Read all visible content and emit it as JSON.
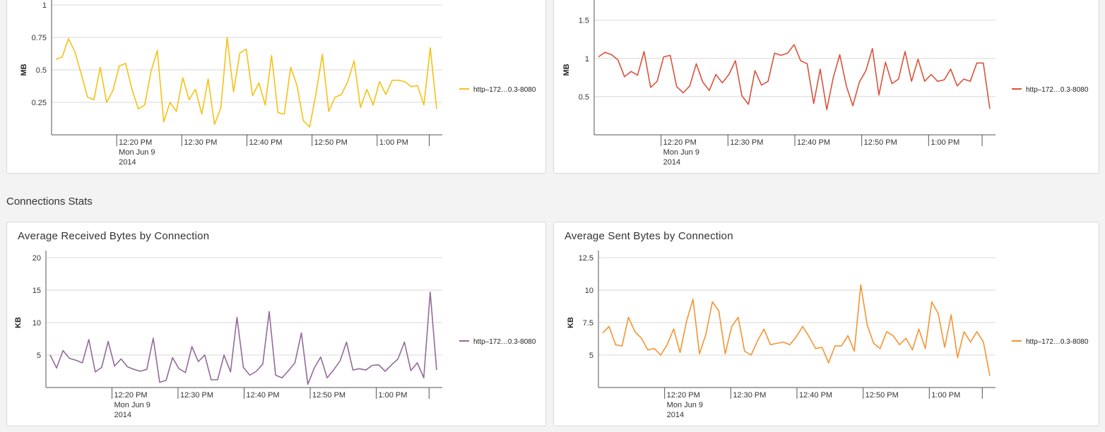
{
  "section": {
    "title": "Connections Stats"
  },
  "charts": [
    {
      "id": "top-left",
      "title": "",
      "ylabel": "MB",
      "yticks": [
        "1",
        "0.75",
        "0.5",
        "0.25"
      ],
      "xticks": [
        "12:20 PM",
        "12:30 PM",
        "12:40 PM",
        "12:50 PM",
        "1:00 PM"
      ],
      "xsub": [
        "Mon Jun 9",
        "2014"
      ],
      "legend": "http–172…0.3-8080",
      "color": "#f5c115"
    },
    {
      "id": "top-right",
      "title": "",
      "ylabel": "MB",
      "yticks": [
        "1.5",
        "1",
        "0.5"
      ],
      "xticks": [
        "12:20 PM",
        "12:30 PM",
        "12:40 PM",
        "12:50 PM",
        "1:00 PM"
      ],
      "xsub": [
        "Mon Jun 9",
        "2014"
      ],
      "legend": "http–172…0.3-8080",
      "color": "#d9533b"
    },
    {
      "id": "bottom-left",
      "title": "Average Received Bytes by Connection",
      "ylabel": "KB",
      "yticks": [
        "20",
        "15",
        "10",
        "5"
      ],
      "xticks": [
        "12:20 PM",
        "12:30 PM",
        "12:40 PM",
        "12:50 PM",
        "1:00 PM"
      ],
      "xsub": [
        "Mon Jun 9",
        "2014"
      ],
      "legend": "http–172…0.3-8080",
      "color": "#946a9a"
    },
    {
      "id": "bottom-right",
      "title": "Average Sent Bytes by Connection",
      "ylabel": "KB",
      "yticks": [
        "12.5",
        "10",
        "7.5",
        "5"
      ],
      "xticks": [
        "12:20 PM",
        "12:30 PM",
        "12:40 PM",
        "12:50 PM",
        "1:00 PM"
      ],
      "xsub": [
        "Mon Jun 9",
        "2014"
      ],
      "legend": "http–172…0.3-8080",
      "color": "#f39433"
    }
  ],
  "chart_data": [
    {
      "type": "line",
      "ylabel": "MB",
      "ylim": [
        0,
        1
      ],
      "xlabel": "",
      "x_start": "12:10 PM",
      "x_end": "1:10 PM",
      "series": [
        {
          "name": "http–172…0.3-8080",
          "values": [
            0.58,
            0.6,
            0.74,
            0.64,
            0.47,
            0.29,
            0.27,
            0.52,
            0.25,
            0.34,
            0.53,
            0.55,
            0.35,
            0.2,
            0.23,
            0.49,
            0.65,
            0.1,
            0.25,
            0.18,
            0.44,
            0.27,
            0.35,
            0.16,
            0.43,
            0.08,
            0.21,
            0.75,
            0.33,
            0.63,
            0.66,
            0.3,
            0.4,
            0.23,
            0.61,
            0.17,
            0.16,
            0.52,
            0.38,
            0.11,
            0.06,
            0.32,
            0.62,
            0.18,
            0.29,
            0.31,
            0.41,
            0.57,
            0.21,
            0.35,
            0.23,
            0.41,
            0.31,
            0.42,
            0.42,
            0.41,
            0.37,
            0.38,
            0.23,
            0.67,
            0.2
          ]
        }
      ]
    },
    {
      "type": "line",
      "ylabel": "MB",
      "ylim": [
        0,
        1.7
      ],
      "xlabel": "",
      "x_start": "12:10 PM",
      "x_end": "1:10 PM",
      "series": [
        {
          "name": "http–172…0.3-8080",
          "values": [
            1.02,
            1.08,
            1.05,
            0.98,
            0.76,
            0.83,
            0.78,
            1.09,
            0.62,
            0.7,
            1.02,
            1.04,
            0.63,
            0.55,
            0.64,
            0.93,
            0.69,
            0.58,
            0.79,
            0.68,
            0.79,
            0.97,
            0.51,
            0.4,
            0.84,
            0.65,
            0.7,
            1.07,
            1.04,
            1.07,
            1.18,
            0.97,
            0.93,
            0.41,
            0.86,
            0.33,
            0.75,
            1.05,
            0.64,
            0.38,
            0.69,
            0.84,
            1.13,
            0.52,
            0.95,
            0.67,
            0.73,
            1.09,
            0.7,
            0.99,
            0.7,
            0.79,
            0.7,
            0.72,
            0.86,
            0.64,
            0.73,
            0.7,
            0.94,
            0.94,
            0.34
          ]
        }
      ]
    },
    {
      "type": "line",
      "ylabel": "KB",
      "ylim": [
        0,
        20
      ],
      "xlabel": "",
      "x_start": "12:10 PM",
      "x_end": "1:10 PM",
      "series": [
        {
          "name": "http–172…0.3-8080",
          "values": [
            5,
            3,
            5.7,
            4.5,
            4.2,
            3.8,
            7.4,
            2.4,
            3.1,
            7.1,
            3.3,
            4.4,
            3.2,
            2.8,
            2.5,
            2.8,
            7.6,
            0.8,
            1.1,
            4.6,
            2.9,
            2.3,
            6.3,
            4,
            5,
            1.2,
            1.2,
            5,
            2.4,
            10.8,
            3.1,
            1.9,
            2.5,
            3.6,
            11.7,
            1.9,
            1.5,
            2.6,
            3.8,
            8.4,
            0.5,
            3,
            4.7,
            1.5,
            2.7,
            4.1,
            7,
            2.7,
            2.9,
            2.7,
            3.4,
            3.5,
            2.5,
            3.5,
            4.4,
            7,
            2.6,
            3.8,
            1.5,
            14.7,
            2.7
          ]
        }
      ]
    },
    {
      "type": "line",
      "ylabel": "KB",
      "ylim": [
        2.5,
        12.5
      ],
      "xlabel": "",
      "x_start": "12:10 PM",
      "x_end": "1:10 PM",
      "series": [
        {
          "name": "http–172…0.3-8080",
          "values": [
            6.7,
            7.2,
            5.8,
            5.7,
            7.9,
            6.8,
            6.3,
            5.4,
            5.5,
            5,
            5.8,
            7,
            5.2,
            7.6,
            9.3,
            5.1,
            6.6,
            9.1,
            8.4,
            5.1,
            7.2,
            7.9,
            5.3,
            5,
            6.1,
            7,
            5.8,
            5.9,
            6,
            5.8,
            6.4,
            7.2,
            6.4,
            5.5,
            5.6,
            4.4,
            5.7,
            5.7,
            6.5,
            5.3,
            10.4,
            7.3,
            5.9,
            5.5,
            6.8,
            6.5,
            5.8,
            6.3,
            5.4,
            7,
            5.5,
            9.1,
            8.2,
            5.6,
            8.1,
            4.8,
            6.8,
            6,
            6.8,
            6,
            3.4
          ]
        }
      ]
    }
  ]
}
